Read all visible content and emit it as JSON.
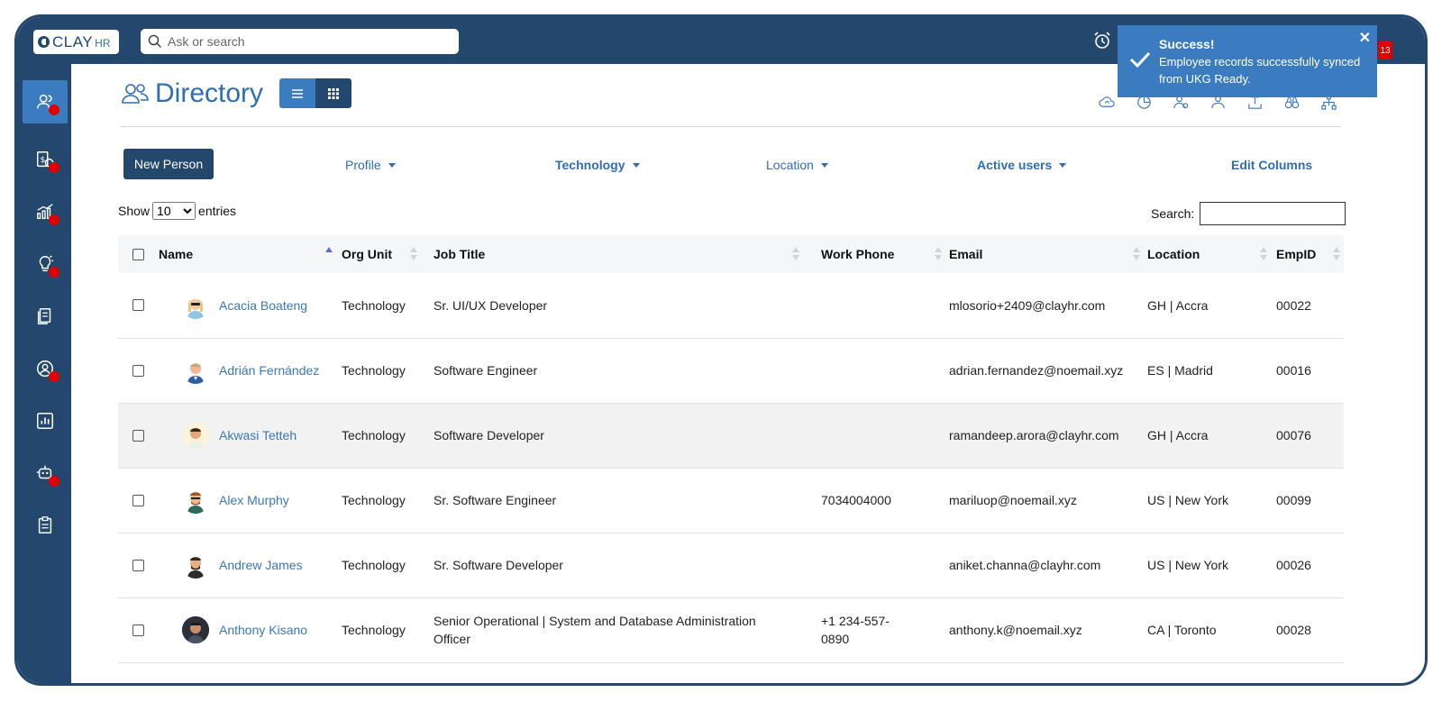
{
  "app": {
    "logo_text": "CLAY",
    "logo_suffix": "HR",
    "search_placeholder": "Ask or search",
    "notification_count": "13"
  },
  "sidebar": {
    "items": [
      {
        "icon": "people-icon",
        "active": true,
        "dot": true
      },
      {
        "icon": "payroll-icon",
        "active": false,
        "dot": true
      },
      {
        "icon": "growth-chart-icon",
        "active": false,
        "dot": true
      },
      {
        "icon": "idea-bulb-icon",
        "active": false,
        "dot": true
      },
      {
        "icon": "documents-icon",
        "active": false,
        "dot": false
      },
      {
        "icon": "user-circle-icon",
        "active": false,
        "dot": true
      },
      {
        "icon": "report-chart-icon",
        "active": false,
        "dot": false
      },
      {
        "icon": "bot-icon",
        "active": false,
        "dot": true
      },
      {
        "icon": "checklist-icon",
        "active": false,
        "dot": false
      }
    ]
  },
  "page": {
    "title": "Directory",
    "new_person_label": "New Person",
    "filters": {
      "profile": "Profile",
      "technology": "Technology",
      "location": "Location",
      "active_users": "Active users",
      "edit_columns": "Edit Columns"
    },
    "show_label": "Show",
    "entries_label": "entries",
    "page_size": "10",
    "search_label": "Search:"
  },
  "table": {
    "columns": [
      "Name",
      "Org Unit",
      "Job Title",
      "Work Phone",
      "Email",
      "Location",
      "EmpID"
    ],
    "rows": [
      {
        "name": "Acacia Boateng",
        "org": "Technology",
        "title": "Sr. UI/UX Developer",
        "phone": "",
        "email": "mlosorio+2409@clayhr.com",
        "location": "GH | Accra",
        "empid": "00022"
      },
      {
        "name": "Adrián Fernández",
        "org": "Technology",
        "title": "Software Engineer",
        "phone": "",
        "email": "adrian.fernandez@noemail.xyz",
        "location": "ES | Madrid",
        "empid": "00016"
      },
      {
        "name": "Akwasi Tetteh",
        "org": "Technology",
        "title": "Software Developer",
        "phone": "",
        "email": "ramandeep.arora@clayhr.com",
        "location": "GH | Accra",
        "empid": "00076"
      },
      {
        "name": "Alex Murphy",
        "org": "Technology",
        "title": "Sr. Software Engineer",
        "phone": "7034004000",
        "email": "mariluop@noemail.xyz",
        "location": "US | New York",
        "empid": "00099"
      },
      {
        "name": "Andrew James",
        "org": "Technology",
        "title": "Sr. Software Developer",
        "phone": "",
        "email": "aniket.channa@clayhr.com",
        "location": "US | New York",
        "empid": "00026"
      },
      {
        "name": "Anthony Kisano",
        "org": "Technology",
        "title": "Senior Operational | System and Database Administration Officer",
        "phone": "+1 234-557-0890",
        "email": "anthony.k@noemail.xyz",
        "location": "CA | Toronto",
        "empid": "00028"
      }
    ]
  },
  "toast": {
    "title": "Success!",
    "message": "Employee records successfully synced from UKG Ready."
  },
  "colors": {
    "nav": "#24476d",
    "accent": "#3b7cc0",
    "link": "#2f6db5",
    "dot": "#e00000"
  }
}
